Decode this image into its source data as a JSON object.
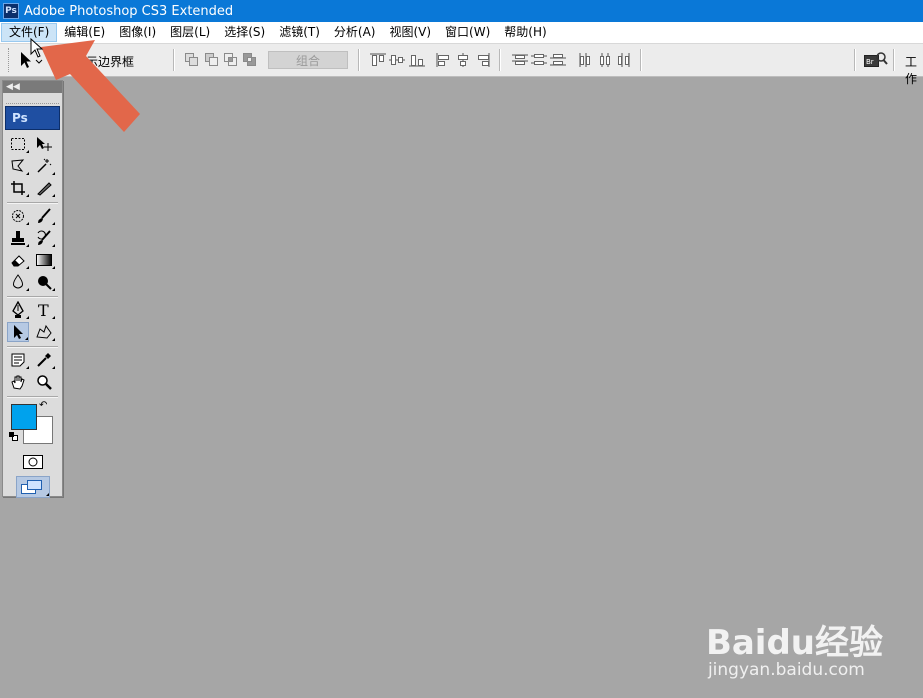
{
  "window": {
    "title": "Adobe Photoshop CS3 Extended",
    "app_icon_text": "Ps"
  },
  "menubar": {
    "items": [
      {
        "label": "文件(F)",
        "active": true
      },
      {
        "label": "编辑(E)"
      },
      {
        "label": "图像(I)"
      },
      {
        "label": "图层(L)"
      },
      {
        "label": "选择(S)"
      },
      {
        "label": "滤镜(T)"
      },
      {
        "label": "分析(A)"
      },
      {
        "label": "视图(V)"
      },
      {
        "label": "窗口(W)"
      },
      {
        "label": "帮助(H)"
      }
    ]
  },
  "options_bar": {
    "show_bounding_box_label": "示边界框",
    "combine_button": "组合",
    "workspace_label": "工作"
  },
  "toolbox": {
    "logo": "Ps"
  },
  "colors": {
    "foreground": "#00a2ed",
    "background": "#ffffff",
    "arrow": "#e2674a"
  },
  "watermark": {
    "brand": "Baidu经验",
    "url": "jingyan.baidu.com"
  }
}
